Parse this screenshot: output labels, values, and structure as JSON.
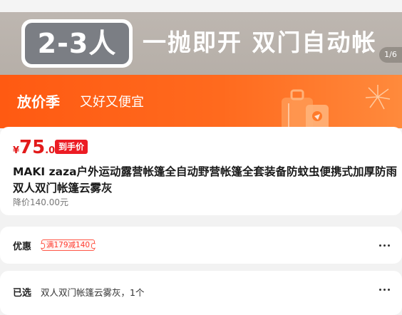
{
  "hero": {
    "badge": "2-3人",
    "slogan": "一抛即开  双门自动帐",
    "page_indicator": "1/6"
  },
  "promo": {
    "title": "放价季",
    "subtitle": "又好又便宜",
    "icons": [
      "luggage-icon",
      "fireworks-icon"
    ]
  },
  "price": {
    "currency": "¥",
    "integer": "75",
    "decimal": ".00",
    "tag": "到手价",
    "color": "#e21a1a"
  },
  "product": {
    "title": "MAKI zaza户外运动露营帐篷全自动野营帐篷全套装备防蚊虫便携式加厚防雨 双人双门帐篷云雾灰",
    "reduced_price": "降价140.00元"
  },
  "discount": {
    "label": "优惠",
    "coupon": "满179减140"
  },
  "selected": {
    "label": "已选",
    "value": "双人双门帐篷云雾灰，1个"
  }
}
